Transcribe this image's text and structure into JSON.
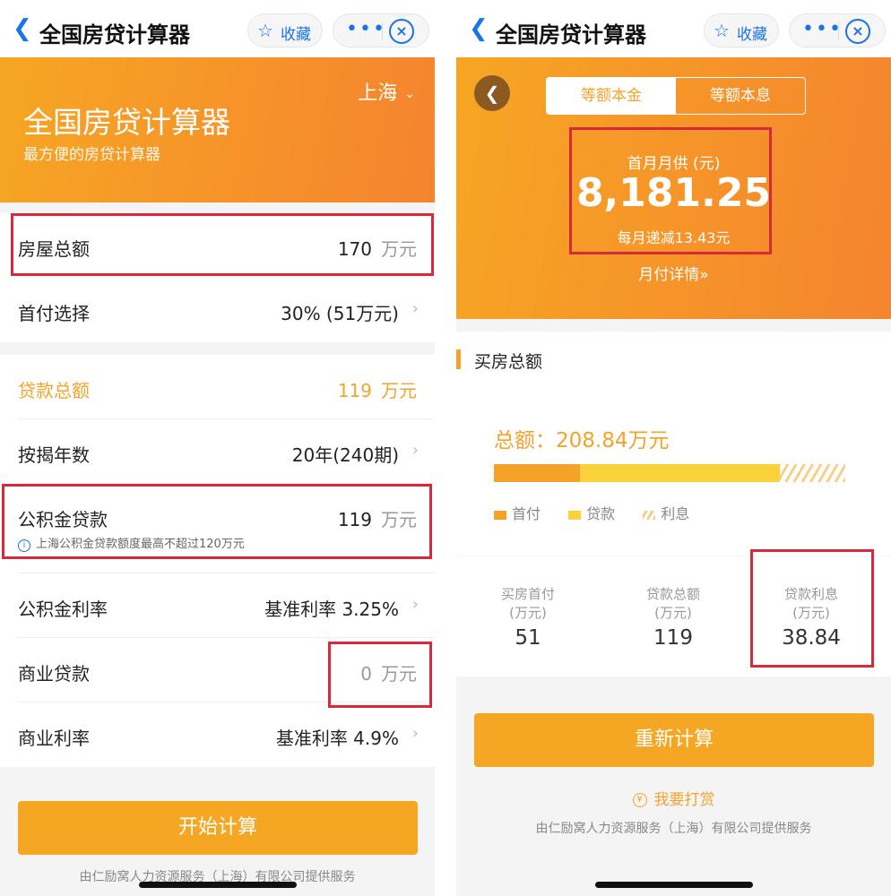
{
  "nav": {
    "title": "全国房贷计算器",
    "fav_label": "收藏",
    "more_glyph": "•••",
    "close_glyph": "×"
  },
  "left": {
    "banner": {
      "city": "上海",
      "title": "全国房贷计算器",
      "subtitle": "最方便的房贷计算器"
    },
    "rows": {
      "house_total": {
        "label": "房屋总额",
        "value": "170",
        "unit": "万元"
      },
      "down_payment": {
        "label": "首付选择",
        "value": "30% (51万元)"
      },
      "loan_total": {
        "label": "贷款总额",
        "value": "119",
        "unit": "万元"
      },
      "years": {
        "label": "按揭年数",
        "value": "20年(240期)"
      },
      "fund_loan": {
        "label": "公积金贷款",
        "value": "119",
        "unit": "万元",
        "hint": "上海公积金贷款额度最高不超过120万元"
      },
      "fund_rate": {
        "label": "公积金利率",
        "value": "基准利率 3.25%"
      },
      "commercial_loan": {
        "label": "商业贷款",
        "value": "0",
        "unit": "万元"
      },
      "commercial_rate": {
        "label": "商业利率",
        "value": "基准利率 4.9%"
      }
    },
    "button": "开始计算",
    "footer": "由仁励窝人力资源服务（上海）有限公司提供服务"
  },
  "right": {
    "tabs": [
      "等额本金",
      "等额本息"
    ],
    "active_tab": 0,
    "first_month_label": "首月月供 (元)",
    "first_month_amount": "8,181.25",
    "monthly_decrease": "每月递减13.43元",
    "detail_link": "月付详情»",
    "section_title": "买房总额",
    "total_line": "总额：208.84万元",
    "legend": [
      "首付",
      "贷款",
      "利息"
    ],
    "stats": [
      {
        "label1": "买房首付",
        "label2": "(万元)",
        "value": "51"
      },
      {
        "label1": "贷款总额",
        "label2": "(万元)",
        "value": "119"
      },
      {
        "label1": "贷款利息",
        "label2": "(万元)",
        "value": "38.84"
      }
    ],
    "composition": {
      "down_payment": 51,
      "loan": 119,
      "interest": 38.84,
      "total": 208.84
    },
    "button": "重新计算",
    "tip_link": "我要打赏",
    "tip_glyph": "¥",
    "footer": "由仁励窝人力资源服务（上海）有限公司提供服务"
  },
  "colors": {
    "brand_orange": "#f5a623",
    "link_blue": "#1a73e8",
    "highlight_red": "#d9283a",
    "loan_yellow": "#fbd23c"
  }
}
